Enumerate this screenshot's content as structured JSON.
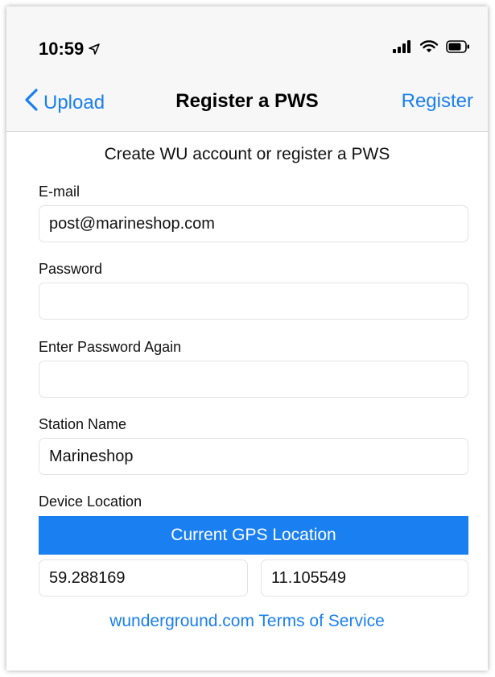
{
  "status_bar": {
    "time": "10:59"
  },
  "nav": {
    "back_label": "Upload",
    "title": "Register a PWS",
    "action_label": "Register"
  },
  "form": {
    "subtitle": "Create WU account or register a PWS",
    "email": {
      "label": "E-mail",
      "value": "post@marineshop.com"
    },
    "password": {
      "label": "Password",
      "value": ""
    },
    "password_again": {
      "label": "Enter Password Again",
      "value": ""
    },
    "station_name": {
      "label": "Station Name",
      "value": "Marineshop"
    },
    "device_location": {
      "label": "Device Location",
      "gps_button_label": "Current GPS Location",
      "latitude": "59.288169",
      "longitude": "11.105549"
    },
    "terms_link": "wunderground.com Terms of Service"
  },
  "colors": {
    "accent": "#1a7ff0",
    "header_bg": "#f7f7f7"
  },
  "icons": [
    "location-arrow-icon",
    "signal-icon",
    "wifi-icon",
    "battery-icon",
    "chevron-left-icon"
  ]
}
